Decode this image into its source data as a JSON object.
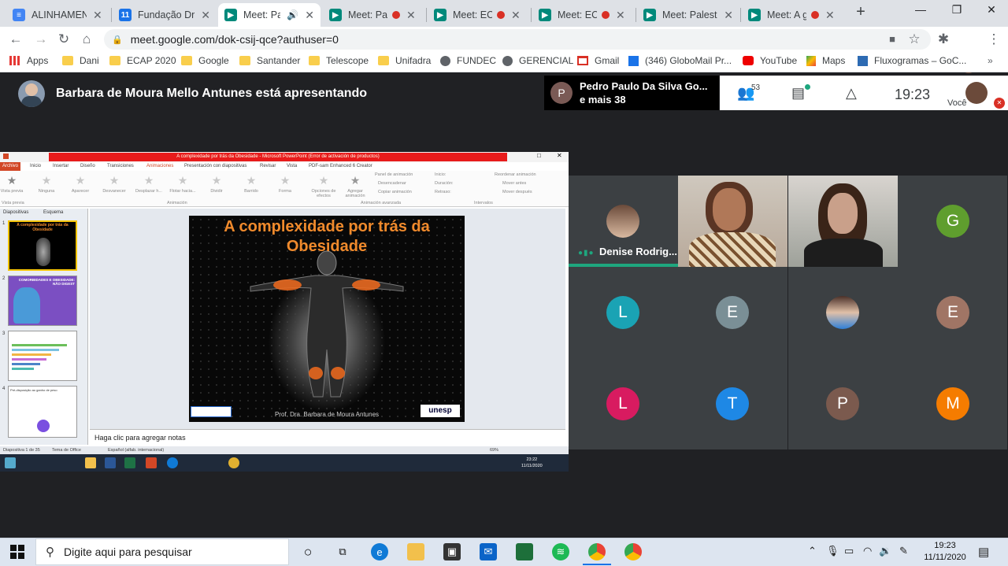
{
  "browser": {
    "tabs": [
      {
        "title": "ALINHAMENTO",
        "favicon": "docs-icon",
        "color": "#4285f4"
      },
      {
        "title": "Fundação Drac",
        "favicon": "calendar-icon",
        "color": "#1a73e8"
      },
      {
        "title": "Meet: Palestra",
        "favicon": "meet-icon",
        "color": "#00897b",
        "active": true
      },
      {
        "title": "Meet: Palestra",
        "favicon": "meet-icon",
        "color": "#00897b"
      },
      {
        "title": "Meet: ECAP",
        "favicon": "meet-icon",
        "color": "#00897b"
      },
      {
        "title": "Meet: ECAP",
        "favicon": "meet-icon",
        "color": "#00897b"
      },
      {
        "title": "Meet: Palestra",
        "favicon": "meet-icon",
        "color": "#00897b"
      },
      {
        "title": "Meet: A gr",
        "favicon": "meet-icon",
        "color": "#00897b"
      }
    ],
    "address": "meet.google.com/dok-csij-qce?authuser=0",
    "bookmarks": [
      {
        "label": "Apps",
        "icon": "apps-grid-icon"
      },
      {
        "label": "Dani",
        "icon": "folder-icon"
      },
      {
        "label": "ECAP 2020",
        "icon": "folder-icon"
      },
      {
        "label": "Google",
        "icon": "folder-icon"
      },
      {
        "label": "Santander",
        "icon": "folder-icon"
      },
      {
        "label": "Telescope",
        "icon": "folder-icon"
      },
      {
        "label": "Unifadra",
        "icon": "folder-icon"
      },
      {
        "label": "FUNDEC",
        "icon": "globe-icon"
      },
      {
        "label": "GERENCIAL",
        "icon": "globe-icon"
      },
      {
        "label": "Gmail",
        "icon": "gmail-icon"
      },
      {
        "label": "(346) GloboMail Pr...",
        "icon": "globomail-icon"
      },
      {
        "label": "YouTube",
        "icon": "youtube-icon"
      },
      {
        "label": "Maps",
        "icon": "maps-icon"
      },
      {
        "label": "Fluxogramas – GoC...",
        "icon": "flowchart-icon"
      }
    ]
  },
  "meet": {
    "presenter_text": "Barbara de Moura Mello Antunes está apresentando",
    "chat_popup": {
      "initial": "P",
      "line1": "Pedro Paulo Da Silva Go...",
      "line2": "e mais 38"
    },
    "participants_count": "53",
    "clock": "19:23",
    "you_label": "Você",
    "participants": [
      {
        "name": "Denise Rodrig...",
        "type": "photo"
      },
      {
        "name": "",
        "type": "video"
      },
      {
        "name": "",
        "type": "video"
      },
      {
        "initial": "G",
        "color": "#5f9e2e"
      },
      {
        "initial": "L",
        "color": "#1aa3b4"
      },
      {
        "initial": "E",
        "color": "#7a8f96"
      },
      {
        "name": "",
        "type": "photo"
      },
      {
        "initial": "E",
        "color": "#a07565"
      },
      {
        "initial": "L",
        "color": "#d81b60"
      },
      {
        "initial": "T",
        "color": "#1e88e5"
      },
      {
        "initial": "P",
        "color": "#7b5a4e"
      },
      {
        "initial": "M",
        "color": "#f57c00"
      }
    ]
  },
  "ppt": {
    "window_title": "A complexidade por trás da Obesidade - Microsoft PowerPoint (Error de activación de productos)",
    "menu": [
      "Archivo",
      "Inicio",
      "Insertar",
      "Diseño",
      "Transiciones",
      "Animaciones",
      "Presentación con diapositivas",
      "Revisar",
      "Vista",
      "PDF-sam Enhanced 6 Creator"
    ],
    "ribbon": [
      "Vista previa",
      "Ninguna",
      "Aparecer",
      "Desvanecer",
      "Desplazar h...",
      "Flotar hacia...",
      "Dividir",
      "Barrido",
      "Forma",
      "Opciones de efectos",
      "Agregar animación"
    ],
    "ribbon_right": [
      "Panel de animación",
      "Desencadenar",
      "Copiar animación",
      "Inicio:",
      "Duración:",
      "Retraso:",
      "Reordenar animación",
      "Mover antes",
      "Mover después"
    ],
    "ribbon_groups": [
      "Vista previa",
      "Animación",
      "Animación avanzada",
      "Intervalos"
    ],
    "panel_tabs": [
      "Diapositivas",
      "Esquema"
    ],
    "thumbs": [
      {
        "num": "1",
        "caption": "A complexidade por trás da Obesidade"
      },
      {
        "num": "2",
        "caption": "COMORBIDADES E OBESIDADE: NÃO DIGEST"
      },
      {
        "num": "3",
        "caption": ""
      },
      {
        "num": "4",
        "caption": "Pré-disposição ao ganho de peso"
      }
    ],
    "slide_title": "A complexidade por trás da Obesidade",
    "slide_author": "Prof. Dra. Barbara de Moura Antunes",
    "slide_logo": "unesp",
    "notes_placeholder": "Haga clic para agregar notas",
    "status": [
      "Diapositiva 1 de 35",
      "Tema de Office",
      "Español (alfab. internacional)",
      "69%"
    ],
    "small_clock": {
      "time": "23:22",
      "date": "11/11/2020"
    }
  },
  "windows": {
    "search_placeholder": "Digite aqui para pesquisar",
    "clock": {
      "time": "19:23",
      "date": "11/11/2020"
    }
  }
}
